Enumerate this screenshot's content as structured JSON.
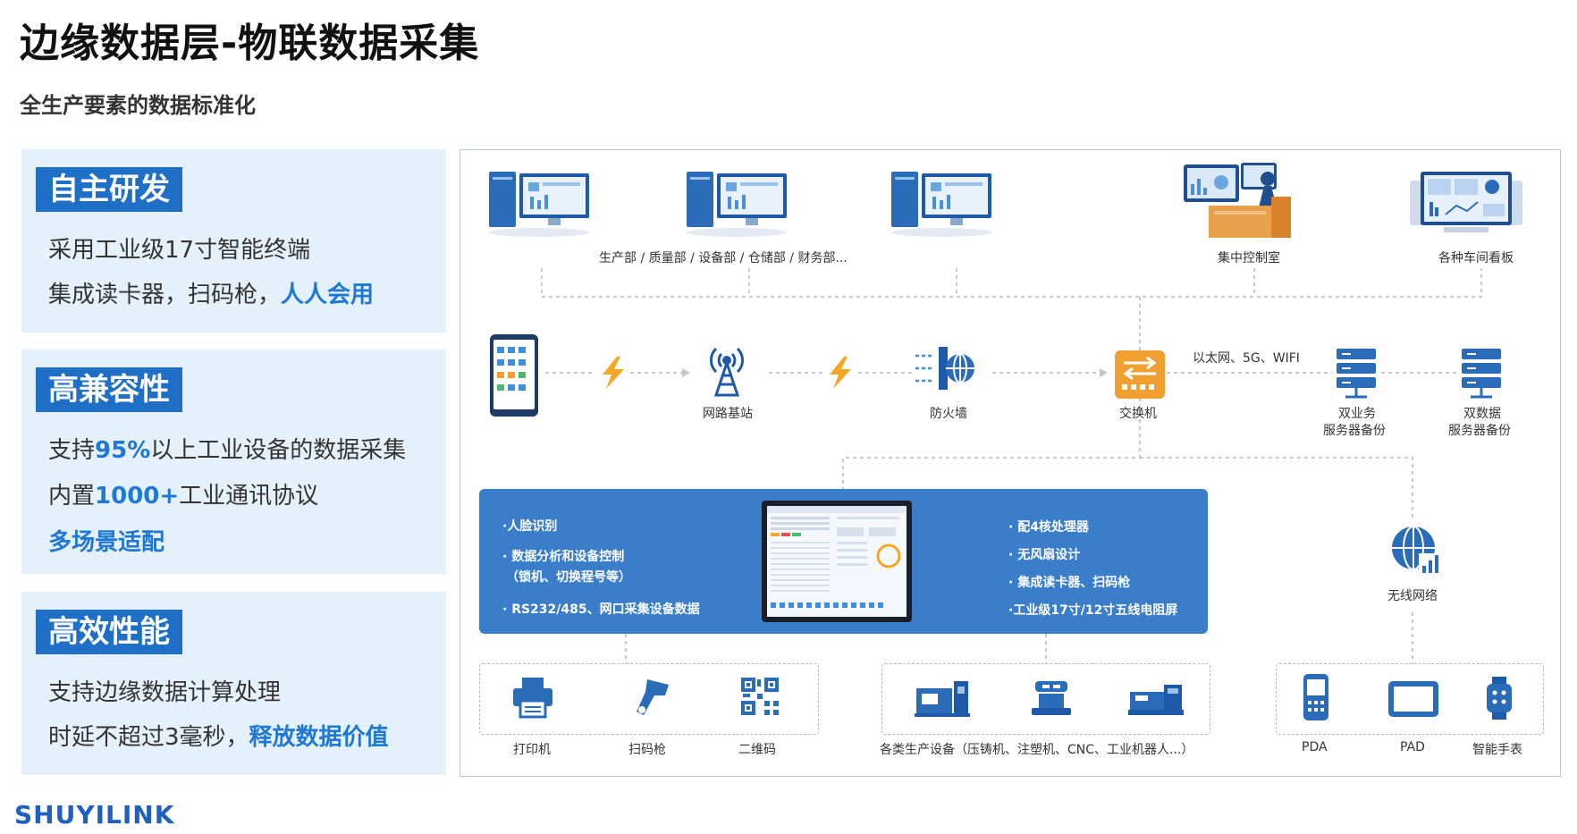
{
  "title": "边缘数据层-物联数据采集",
  "subtitle": "全生产要素的数据标准化",
  "left_panels": [
    {
      "badge": "自主研发",
      "line1": "采用工业级17寸智能终端",
      "line2_a": "集成读卡器，扫码枪，",
      "line2_b": "人人会用"
    },
    {
      "badge": "高兼容性",
      "line1_a": "支持",
      "line1_b": "95%",
      "line1_c": "以上工业设备的数据采集",
      "line2_a": "内置",
      "line2_b": "1000+",
      "line2_c": "工业通讯协议",
      "line3": "多场景适配"
    },
    {
      "badge": "高效性能",
      "line1": "支持边缘数据计算处理",
      "line2_a": "时延不超过3毫秒，",
      "line2_b": "释放数据价值"
    }
  ],
  "logo": "SHUYILINK",
  "diagram": {
    "top_labels": {
      "departments": "生产部 / 质量部 / 设备部 / 仓储部 / 财务部...",
      "control_room": "集中控制室",
      "workshop_board": "各种车间看板"
    },
    "middle_labels": {
      "base_station": "网路基站",
      "firewall": "防火墙",
      "switch": "交换机",
      "network": "以太网、5G、WIFI",
      "server1_a": "双业务",
      "server1_b": "服务器备份",
      "server2_a": "双数据",
      "server2_b": "服务器备份"
    },
    "terminal_features_left": [
      "·人脸识别",
      "· 数据分析和设备控制",
      "（锁机、切换程号等）",
      "· RS232/485、网口采集设备数据"
    ],
    "terminal_features_right": [
      "· 配4核处理器",
      "· 无风扇设计",
      "· 集成读卡器、扫码枪",
      "·工业级17寸/12寸五线电阻屏"
    ],
    "wireless": "无线网络",
    "bottom_labels": {
      "printer": "打印机",
      "scanner": "扫码枪",
      "qrcode": "二维码",
      "equipment": "各类生产设备（压铸机、注塑机、CNC、工业机器人...）",
      "pda": "PDA",
      "pad": "PAD",
      "watch": "智能手表"
    }
  },
  "colors": {
    "accent": "#1f6fc6",
    "panel_bg": "#e4f0fa",
    "highlight": "#1f78d1",
    "terminal_panel": "#3a7ec9",
    "bolt": "#f5a623",
    "switch": "#f0a030"
  }
}
